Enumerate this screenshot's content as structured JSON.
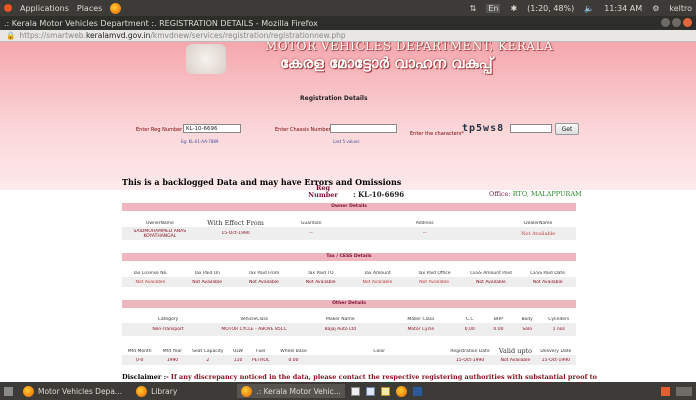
{
  "topbar": {
    "applications": "Applications",
    "places": "Places",
    "lang": "En",
    "battery": "(1:20, 48%)",
    "time": "11:34 AM",
    "user": "keltro"
  },
  "window": {
    "title": ".: Kerala Motor Vehicles Department :. REGISTRATION DETAILS - Mozilla Firefox"
  },
  "url": {
    "prefix": "https://smartweb.",
    "domain": "keralamvd.gov.in",
    "path": "/kmvdnew/services/registration/registrationnew.php"
  },
  "header": {
    "dept": "MOTOR VEHICLES DEPARTMENT, KERALA",
    "dept_mal": "കേരള മോട്ടോർ വാഹന വകുപ്പ്"
  },
  "form": {
    "title": "Registration Details",
    "reg_label": "Enter Reg Number",
    "reg_value": "KL-10-6696",
    "reg_hint": "Eg: KL-01-AA-7889",
    "chassis_label": "Enter Chassis Number",
    "chassis_value": "",
    "chassis_hint": "Last 5 values",
    "captcha_label": "Enter the characters*",
    "captcha": "tp5ws8",
    "captcha_value": "",
    "get_label": "Get"
  },
  "backlog": "This is a backlogged Data and may have Errors and Omissions",
  "reg": {
    "label": "Reg Number",
    "value": ": KL-10-6696",
    "office_label": "Office:",
    "office": "RTO, MALAPPURAM"
  },
  "owner": {
    "title": "Owner Details",
    "headers": [
      "OwnerName",
      "With Effect From",
      "Guardian",
      "Address",
      "DealerName"
    ],
    "values": [
      "SAIDMOHAMMED ANAS KOYATHANGAL",
      "15-Oct-1990",
      "--",
      "--",
      "Not Available"
    ]
  },
  "tax": {
    "title": "Tax / CESS Details",
    "headers": [
      "Tax License No.",
      "Tax Paid On",
      "Tax Paid From",
      "Tax Paid TO",
      "Tax Amount",
      "Tax Paid Office",
      "CESS Amount Paid",
      "CESS Paid Date"
    ],
    "values": [
      "Not Available",
      "Not Available",
      "Not Available",
      "Not Available",
      "Not Available",
      "Not Available",
      "Not Available",
      "Not Available"
    ]
  },
  "other": {
    "title": "Other Details",
    "headers1": [
      "Category",
      "VehicleClass",
      "Maker Name",
      "Maker Class",
      "C.C",
      "BHP",
      "Body",
      "Cylinders"
    ],
    "values1": [
      "Non-Transport",
      "MOTOR CYCLE - ABOVE 85CC",
      "Bajaj Auto Ltd",
      "Motor Cycle",
      "0.00",
      "0.00",
      "Solo",
      "1 nos"
    ],
    "headers2": [
      "Mfd Month",
      "Mfd Year",
      "Seat Capacity",
      "ULW",
      "Fuel",
      "Wheel Base",
      "Color",
      "Registration Date",
      "Valid upto",
      "Delivery Date"
    ],
    "values2": [
      "0-0",
      "1990",
      "2",
      "110",
      "PETROL",
      "0.00",
      "",
      "15-Oct-1990",
      "Not Available",
      "15-Oct-1990"
    ]
  },
  "disclaimer": {
    "label": "Disclaimer :-",
    "text": " If any discrepancy noticed in the data, please contact the respective registering authorities with substantial proof to"
  },
  "taskbar": {
    "t1": "Motor Vehicles Depa...",
    "t2": "Library",
    "t3": ".: Kerala Motor Vehic..."
  },
  "colors": {
    "accent": "#f0b6c0",
    "brand": "#7a1030",
    "not_available": "#c23c3c"
  }
}
